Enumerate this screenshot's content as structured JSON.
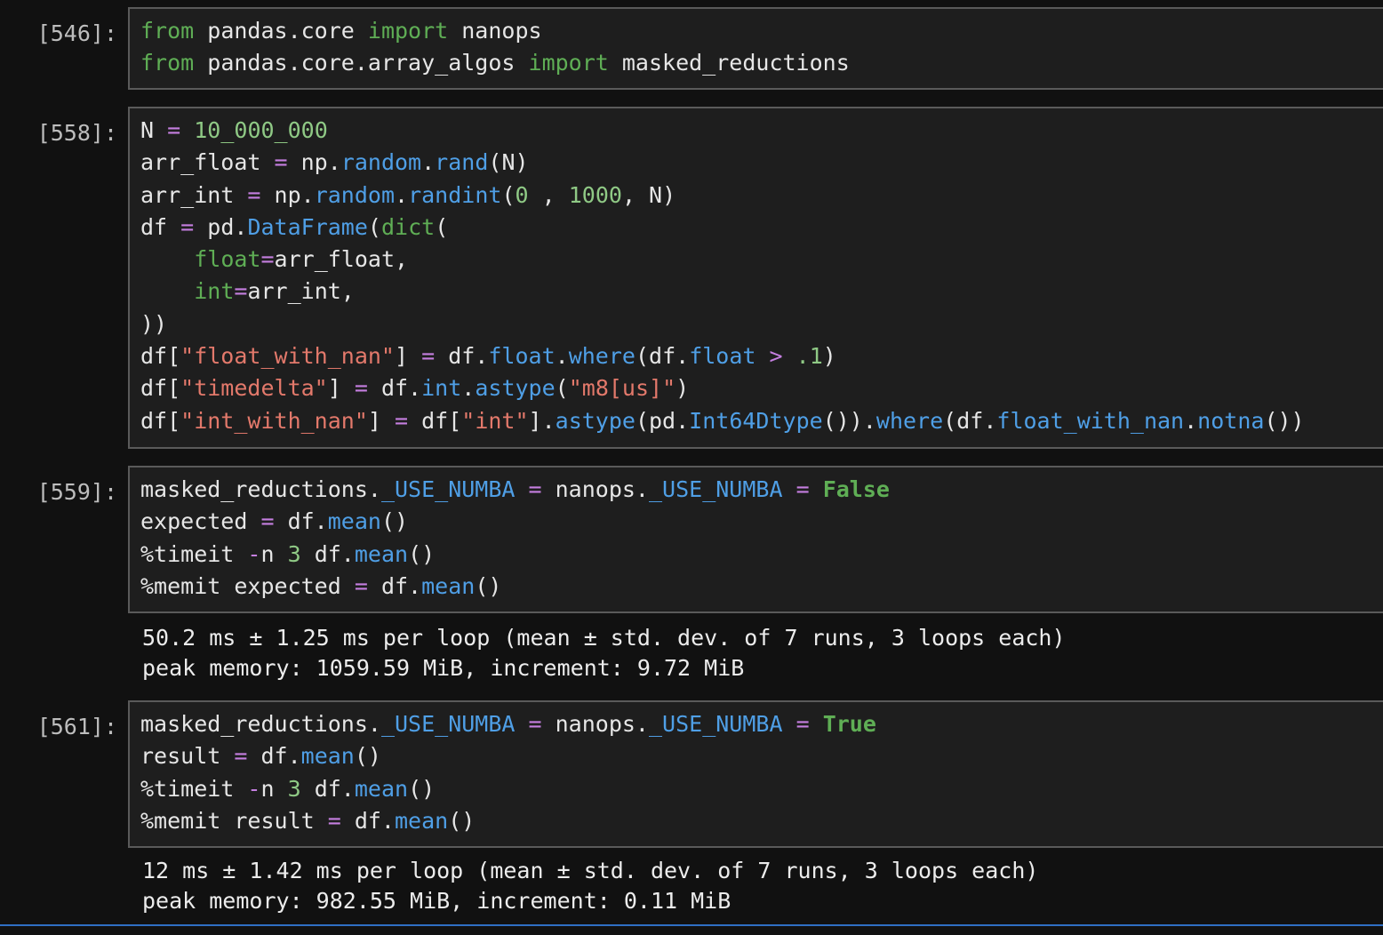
{
  "colors": {
    "keyword": "#5fae55",
    "function": "#4f9fe6",
    "string": "#e3796b",
    "number": "#8fc985",
    "operator": "#c57fe0",
    "plain": "#e6e6e6",
    "builtin": "#5fae55"
  },
  "cells": [
    {
      "prompt": "[546]:",
      "lines": [
        [
          [
            "kw",
            "from"
          ],
          [
            "p",
            " pandas.core "
          ],
          [
            "kw",
            "import"
          ],
          [
            "p",
            " nanops"
          ]
        ],
        [
          [
            "kw",
            "from"
          ],
          [
            "p",
            " pandas.core.array_algos "
          ],
          [
            "kw",
            "import"
          ],
          [
            "p",
            " masked_reductions"
          ]
        ]
      ],
      "output": []
    },
    {
      "prompt": "[558]:",
      "lines": [
        [
          [
            "p",
            "N "
          ],
          [
            "op",
            "="
          ],
          [
            "p",
            " "
          ],
          [
            "num",
            "10_000_000"
          ]
        ],
        [
          [
            "p",
            "arr_float "
          ],
          [
            "op",
            "="
          ],
          [
            "p",
            " np."
          ],
          [
            "fn",
            "random"
          ],
          [
            "p",
            "."
          ],
          [
            "fn",
            "rand"
          ],
          [
            "p",
            "(N)"
          ]
        ],
        [
          [
            "p",
            "arr_int "
          ],
          [
            "op",
            "="
          ],
          [
            "p",
            " np."
          ],
          [
            "fn",
            "random"
          ],
          [
            "p",
            "."
          ],
          [
            "fn",
            "randint"
          ],
          [
            "p",
            "("
          ],
          [
            "num",
            "0"
          ],
          [
            "p",
            " , "
          ],
          [
            "num",
            "1000"
          ],
          [
            "p",
            ", N)"
          ]
        ],
        [
          [
            "p",
            "df "
          ],
          [
            "op",
            "="
          ],
          [
            "p",
            " pd."
          ],
          [
            "fn",
            "DataFrame"
          ],
          [
            "p",
            "("
          ],
          [
            "kw",
            "dict"
          ],
          [
            "p",
            "("
          ]
        ],
        [
          [
            "p",
            "    "
          ],
          [
            "kw",
            "float"
          ],
          [
            "op",
            "="
          ],
          [
            "p",
            "arr_float,"
          ]
        ],
        [
          [
            "p",
            "    "
          ],
          [
            "kw",
            "int"
          ],
          [
            "op",
            "="
          ],
          [
            "p",
            "arr_int,"
          ]
        ],
        [
          [
            "p",
            "))"
          ]
        ],
        [
          [
            "p",
            "df["
          ],
          [
            "str",
            "\"float_with_nan\""
          ],
          [
            "p",
            "] "
          ],
          [
            "op",
            "="
          ],
          [
            "p",
            " df."
          ],
          [
            "fn",
            "float"
          ],
          [
            "p",
            "."
          ],
          [
            "fn",
            "where"
          ],
          [
            "p",
            "(df."
          ],
          [
            "fn",
            "float"
          ],
          [
            "p",
            " "
          ],
          [
            "op",
            ">"
          ],
          [
            "p",
            " "
          ],
          [
            "num",
            ".1"
          ],
          [
            "p",
            ")"
          ]
        ],
        [
          [
            "p",
            "df["
          ],
          [
            "str",
            "\"timedelta\""
          ],
          [
            "p",
            "] "
          ],
          [
            "op",
            "="
          ],
          [
            "p",
            " df."
          ],
          [
            "fn",
            "int"
          ],
          [
            "p",
            "."
          ],
          [
            "fn",
            "astype"
          ],
          [
            "p",
            "("
          ],
          [
            "str",
            "\"m8[us]\""
          ],
          [
            "p",
            ")"
          ]
        ],
        [
          [
            "p",
            "df["
          ],
          [
            "str",
            "\"int_with_nan\""
          ],
          [
            "p",
            "] "
          ],
          [
            "op",
            "="
          ],
          [
            "p",
            " df["
          ],
          [
            "str",
            "\"int\""
          ],
          [
            "p",
            "]."
          ],
          [
            "fn",
            "astype"
          ],
          [
            "p",
            "(pd."
          ],
          [
            "fn",
            "Int64Dtype"
          ],
          [
            "p",
            "())."
          ],
          [
            "fn",
            "where"
          ],
          [
            "p",
            "(df."
          ],
          [
            "fn",
            "float_with_nan"
          ],
          [
            "p",
            "."
          ],
          [
            "fn",
            "notna"
          ],
          [
            "p",
            "())"
          ]
        ]
      ],
      "output": []
    },
    {
      "prompt": "[559]:",
      "lines": [
        [
          [
            "p",
            "masked_reductions."
          ],
          [
            "fn",
            "_USE_NUMBA"
          ],
          [
            "p",
            " "
          ],
          [
            "op",
            "="
          ],
          [
            "p",
            " nanops."
          ],
          [
            "fn",
            "_USE_NUMBA"
          ],
          [
            "p",
            " "
          ],
          [
            "op",
            "="
          ],
          [
            "p",
            " "
          ],
          [
            "kwb",
            "False"
          ]
        ],
        [
          [
            "p",
            "expected "
          ],
          [
            "op",
            "="
          ],
          [
            "p",
            " df."
          ],
          [
            "fn",
            "mean"
          ],
          [
            "p",
            "()"
          ]
        ],
        [
          [
            "p",
            "%timeit "
          ],
          [
            "op",
            "-"
          ],
          [
            "p",
            "n "
          ],
          [
            "num",
            "3"
          ],
          [
            "p",
            " df."
          ],
          [
            "fn",
            "mean"
          ],
          [
            "p",
            "()"
          ]
        ],
        [
          [
            "p",
            "%memit expected "
          ],
          [
            "op",
            "="
          ],
          [
            "p",
            " df."
          ],
          [
            "fn",
            "mean"
          ],
          [
            "p",
            "()"
          ]
        ]
      ],
      "output": [
        "50.2 ms ± 1.25 ms per loop (mean ± std. dev. of 7 runs, 3 loops each)",
        "peak memory: 1059.59 MiB, increment: 9.72 MiB"
      ]
    },
    {
      "prompt": "[561]:",
      "lines": [
        [
          [
            "p",
            "masked_reductions."
          ],
          [
            "fn",
            "_USE_NUMBA"
          ],
          [
            "p",
            " "
          ],
          [
            "op",
            "="
          ],
          [
            "p",
            " nanops."
          ],
          [
            "fn",
            "_USE_NUMBA"
          ],
          [
            "p",
            " "
          ],
          [
            "op",
            "="
          ],
          [
            "p",
            " "
          ],
          [
            "kwb",
            "True"
          ]
        ],
        [
          [
            "p",
            "result "
          ],
          [
            "op",
            "="
          ],
          [
            "p",
            " df."
          ],
          [
            "fn",
            "mean"
          ],
          [
            "p",
            "()"
          ]
        ],
        [
          [
            "p",
            "%timeit "
          ],
          [
            "op",
            "-"
          ],
          [
            "p",
            "n "
          ],
          [
            "num",
            "3"
          ],
          [
            "p",
            " df."
          ],
          [
            "fn",
            "mean"
          ],
          [
            "p",
            "()"
          ]
        ],
        [
          [
            "p",
            "%memit result "
          ],
          [
            "op",
            "="
          ],
          [
            "p",
            " df."
          ],
          [
            "fn",
            "mean"
          ],
          [
            "p",
            "()"
          ]
        ]
      ],
      "output": [
        "12 ms ± 1.42 ms per loop (mean ± std. dev. of 7 runs, 3 loops each)",
        "peak memory: 982.55 MiB, increment: 0.11 MiB"
      ]
    }
  ]
}
